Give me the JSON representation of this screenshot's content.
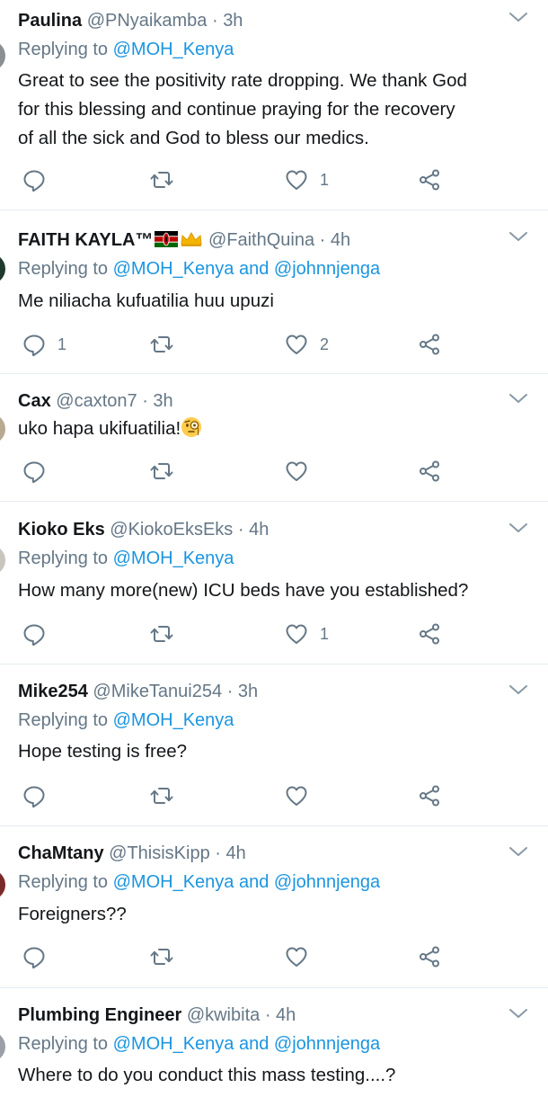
{
  "tweets": [
    {
      "name": "Paulina",
      "handle": "@PNyaikamba",
      "time": "3h",
      "reply_prefix": "Replying to ",
      "reply_to": "@MOH_Kenya",
      "lines": [
        "Great to see the positivity rate dropping. We thank God",
        "for this blessing and continue praying for the recovery",
        "of all the sick and God to bless our medics."
      ],
      "reply_count": "",
      "like_count": "1"
    },
    {
      "name": "FAITH KAYLA™",
      "handle": "@FaithQuina",
      "time": "4h",
      "reply_prefix": "Replying to ",
      "reply_to": "@MOH_Kenya and @johnnjenga",
      "lines": [
        "Me niliacha kufuatilia huu upuzi"
      ],
      "reply_count": "1",
      "like_count": "2"
    },
    {
      "name": "Cax",
      "handle": "@caxton7",
      "time": "3h",
      "lines": [
        "uko hapa ukifuatilia!"
      ],
      "reply_count": "",
      "like_count": ""
    },
    {
      "name": "Kioko Eks",
      "handle": "@KiokoEksEks",
      "time": "4h",
      "reply_prefix": "Replying to ",
      "reply_to": "@MOH_Kenya",
      "lines": [
        "How many more(new) ICU beds have you established?"
      ],
      "reply_count": "",
      "like_count": "1"
    },
    {
      "name": "Mike254",
      "handle": "@MikeTanui254",
      "time": "3h",
      "reply_prefix": "Replying to ",
      "reply_to": "@MOH_Kenya",
      "lines": [
        "Hope testing is free?"
      ],
      "reply_count": "",
      "like_count": ""
    },
    {
      "name": "ChaMtany",
      "handle": "@ThisisKipp",
      "time": "4h",
      "reply_prefix": "Replying to ",
      "reply_to": "@MOH_Kenya and @johnnjenga",
      "lines": [
        "Foreigners??"
      ],
      "reply_count": "",
      "like_count": ""
    },
    {
      "name": "Plumbing Engineer",
      "handle": "@kwibita",
      "time": "4h",
      "reply_prefix": "Replying to ",
      "reply_to": "@MOH_Kenya and @johnnjenga",
      "lines": [
        "Where to do you conduct this mass testing....?"
      ],
      "reply_count": "",
      "like_count": ""
    }
  ],
  "dot": "·",
  "colors": {
    "link": "#1b95e0",
    "secondary": "#657786",
    "divider": "#e6ecf0"
  },
  "icons": [
    "reply-icon",
    "retweet-icon",
    "like-icon",
    "share-icon",
    "caret-down-icon",
    "kenya-flag-icon",
    "crown-icon",
    "monocle-face-emoji"
  ]
}
